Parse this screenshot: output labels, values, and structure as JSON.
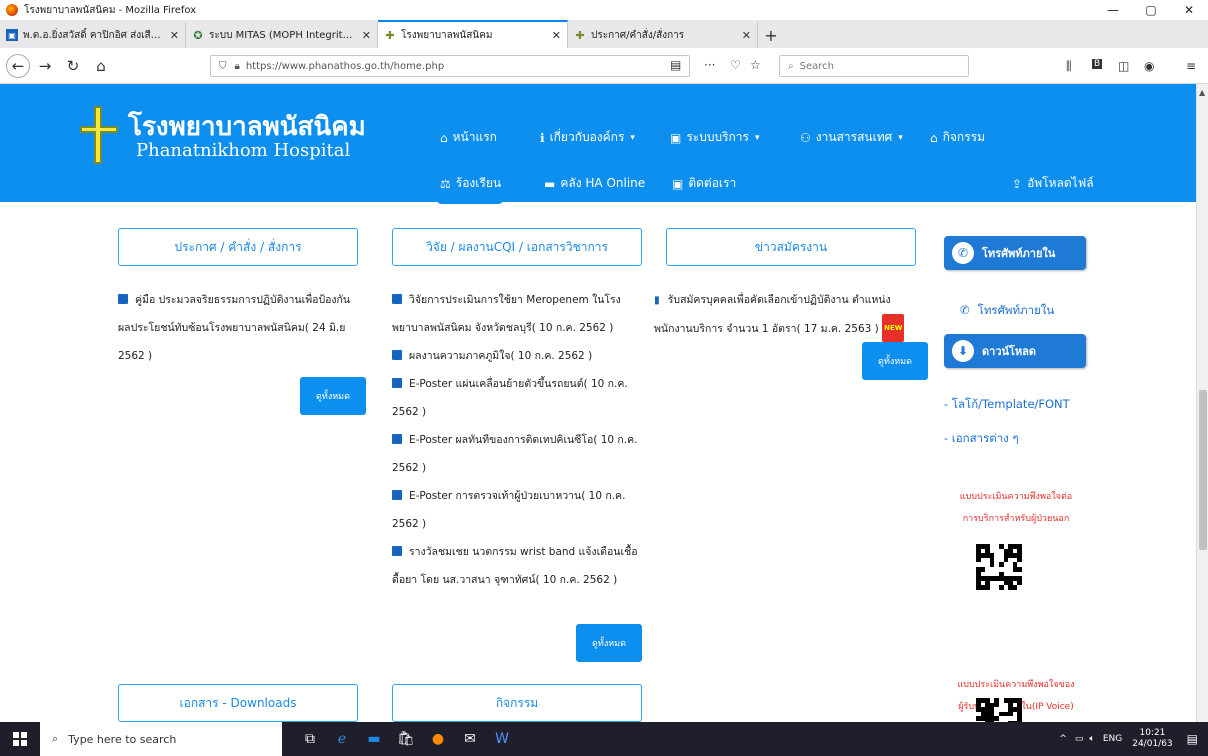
{
  "window": {
    "title": "โรงพยาบาลพนัสนิคม - Mozilla Firefox",
    "min": "—",
    "max": "▢",
    "close": "✕"
  },
  "tabs": [
    {
      "label": "พ.ต.อ.ยิ่งสวัสดิ์ คาปิกอิศ ส่งเสียงใจ",
      "active": false
    },
    {
      "label": "ระบบ MITAS (MOPH Integrity a",
      "active": false
    },
    {
      "label": "โรงพยาบาลพนัสนิคม",
      "active": true
    },
    {
      "label": "ประกาศ/คำสั่ง/สั่งการ",
      "active": false
    }
  ],
  "nav": {
    "url": "https://www.phanathos.go.th/home.php",
    "search_placeholder": "Search",
    "more": "···"
  },
  "site": {
    "name_th": "โรงพยาบาลพนัสนิคม",
    "name_en": "Phanatnikhom Hospital",
    "menu_row1": [
      "หน้าแรก",
      "เกี่ยวกับองค์กร",
      "ระบบบริการ",
      "งานสารสนเทศ",
      "กิจกรรม"
    ],
    "menu_row2": [
      "ร้องเรียน",
      "คลัง HA Online",
      "ติดต่อเรา"
    ],
    "upload": "อัพโหลดไฟล์"
  },
  "sections": {
    "announce": {
      "title": "ประกาศ / คำสั่ง / สั่งการ",
      "items": [
        {
          "text": "คู่มือ ประมวลจริยธรรมการปฏิบัติงานเพื่อป้องกัน",
          "line2": "ผลประโยชน์ทับซ้อนโรงพยาบาลพนัสนิคม( 24 มิ.ย",
          "line3": "2562 )"
        }
      ],
      "all": "ดูทั้งหมด"
    },
    "research": {
      "title": "วิจัย / ผลงานCQI / เอกสารวิชาการ",
      "items": [
        {
          "text": "วิจัยการประเมินการใช้ยา Meropenem ในโรง",
          "line2": "พยาบาลพนัสนิคม จังหวัดชลบุรี( 10 ก.ค. 2562 )"
        },
        {
          "text": "ผลงานความภาคภูมิใจ( 10 ก.ค. 2562 )"
        },
        {
          "text": "E-Poster แผ่นเคลื่อนย้ายตัวขึ้นรถยนต์( 10 ก.ค.",
          "line2": "2562 )"
        },
        {
          "text": "E-Poster ผลทันทีของการติดเทปคิเนซีโอ( 10 ก.ค.",
          "line2": "2562 )"
        },
        {
          "text": "E-Poster การตรวจเท้าผู้ป่วยเบาหวาน( 10 ก.ค.",
          "line2": "2562 )"
        },
        {
          "text": "รางวัลชมเชย นวตกรรม wrist band แจ้งเตือนเชื้อ",
          "line2": "ดื้อยา โดย นส.วาสนา จุฑาทัศน์( 10 ก.ค. 2562 )"
        }
      ],
      "all": "ดูทั้งหมด"
    },
    "jobs": {
      "title": "ข่าวสมัครงาน",
      "items": [
        {
          "text": "รับสมัครบุคคลเพื่อคัดเลือกเข้าปฏิบัติงาน ตำแหน่ง",
          "line2": "พนักงานบริการ จำนวน 1 อัตรา( 17 ม.ค. 2563 )",
          "badge": "NEW"
        }
      ],
      "all": "ดูทั้งหมด"
    },
    "downloads_title": "เอกสาร - Downloads",
    "activities_title": "กิจกรรม"
  },
  "sidebar": {
    "phone_pill": "โทรศัพท์ภายใน",
    "phone_link": "โทรศัพท์ภายใน",
    "download_pill": "ดาวน์โหลด",
    "link1": "- โลโก้/Template/FONT",
    "link2": "- เอกสารต่าง ๆ",
    "survey1": [
      "แบบประเมินความพึงพอใจต่อ",
      "การบริการสำหรับผู้ป่วยนอก"
    ],
    "survey2": [
      "แบบประเมินความพึงพอใจของ",
      "ผู้รับบริการผู้ป่วยใน(IP Voice)"
    ]
  },
  "taskbar": {
    "search": "Type here to search",
    "lang": "ENG",
    "time": "10:21",
    "date": "24/01/63"
  },
  "colors": {
    "header": "#0d8ff0",
    "box_border": "#31a3f2",
    "red": "#e8302a"
  }
}
